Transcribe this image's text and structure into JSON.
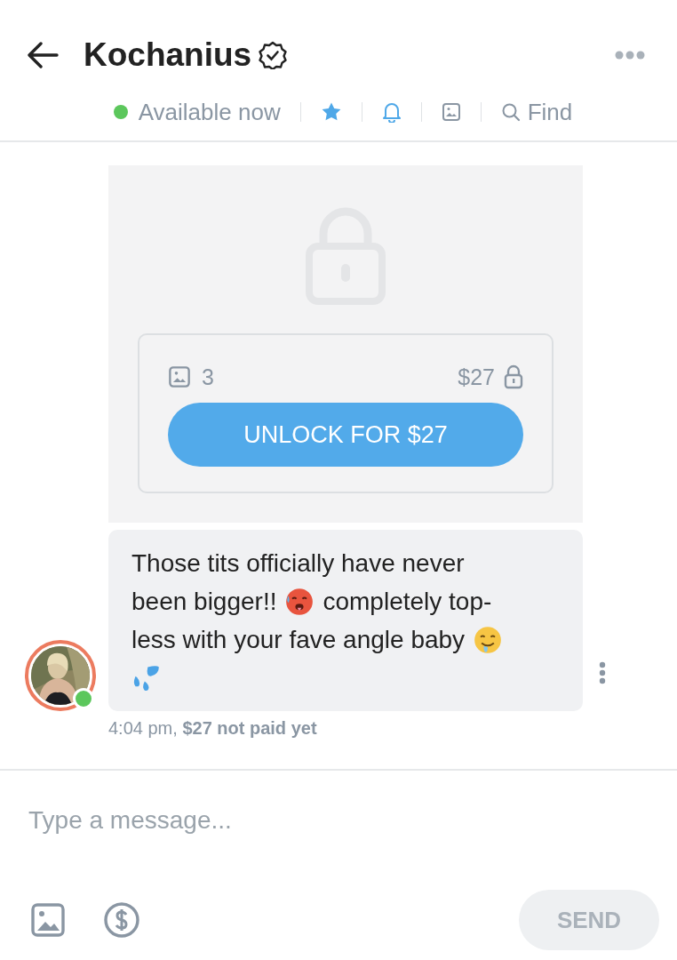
{
  "header": {
    "title": "Kochanius",
    "verified": true,
    "online": true,
    "status": "Available now",
    "find_label": "Find"
  },
  "locked_message": {
    "media_count": "3",
    "price": "$27",
    "unlock_button": "UNLOCK FOR $27"
  },
  "message": {
    "sender_online": true,
    "lines": [
      [
        {
          "kind": "text",
          "text": "Those tits officially have never"
        }
      ],
      [
        {
          "kind": "text",
          "text": "been bigger!!"
        },
        {
          "kind": "hot-face"
        },
        {
          "kind": "text",
          "text": "completely top-"
        }
      ],
      [
        {
          "kind": "text",
          "text": "less with your fave angle baby"
        },
        {
          "kind": "drool-face"
        }
      ],
      [
        {
          "kind": "droplets"
        }
      ]
    ],
    "time": "4:04 pm,",
    "payment_status": "$27 not paid yet"
  },
  "composer": {
    "placeholder": "Type a message...",
    "send_button": "SEND",
    "send_disabled": true
  }
}
